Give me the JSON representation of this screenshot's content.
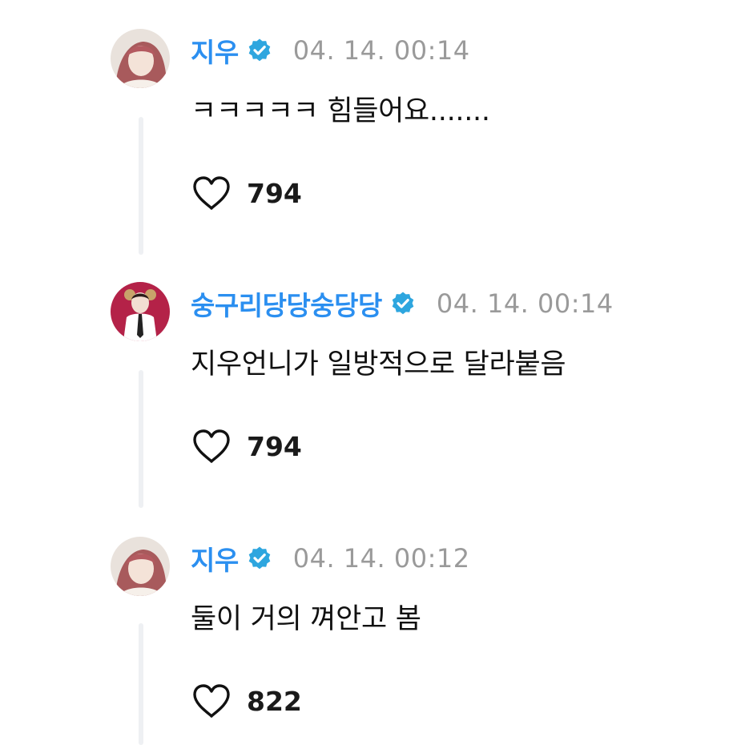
{
  "comments": [
    {
      "username": "지우",
      "verified": true,
      "timestamp": "04. 14. 00:14",
      "text": "ㅋㅋㅋㅋㅋ 힘들어요.......",
      "likes": "794",
      "avatar": "avatar-woman-pink-hair"
    },
    {
      "username": "숭구리당당숭당당",
      "verified": true,
      "timestamp": "04. 14. 00:14",
      "text": "지우언니가 일방적으로 달라붙음",
      "likes": "794",
      "avatar": "avatar-woman-red-background"
    },
    {
      "username": "지우",
      "verified": true,
      "timestamp": "04. 14. 00:12",
      "text": "둘이 거의 껴안고 봄",
      "likes": "822",
      "avatar": "avatar-woman-pink-hair"
    }
  ],
  "colors": {
    "username": "#2b8ff0",
    "verified_badge": "#2ea6df",
    "timestamp": "#9a9a9a",
    "thread_line": "#eef0f3"
  },
  "icons": {
    "verified": "verified-badge-icon",
    "like": "heart-outline-icon"
  }
}
